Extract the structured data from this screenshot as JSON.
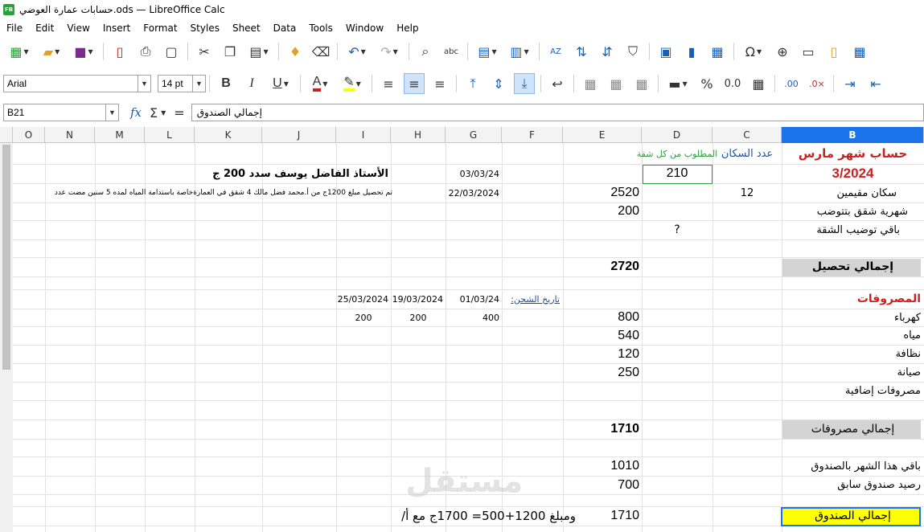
{
  "window": {
    "title": "حسابات عمارة العوضي.ods — LibreOffice Calc",
    "app_icon_text": "FB"
  },
  "menu": [
    "File",
    "Edit",
    "View",
    "Insert",
    "Format",
    "Styles",
    "Sheet",
    "Data",
    "Tools",
    "Window",
    "Help"
  ],
  "format_toolbar": {
    "font_name": "Arial",
    "font_size": "14 pt"
  },
  "formula_bar": {
    "cell_ref": "B21",
    "content": "إجمالي الصندوق"
  },
  "columns": [
    {
      "id": "O",
      "label": "O"
    },
    {
      "id": "N",
      "label": "N"
    },
    {
      "id": "M",
      "label": "M"
    },
    {
      "id": "L",
      "label": "L"
    },
    {
      "id": "K",
      "label": "K"
    },
    {
      "id": "J",
      "label": "J"
    },
    {
      "id": "I",
      "label": "I"
    },
    {
      "id": "H",
      "label": "H"
    },
    {
      "id": "G",
      "label": "G"
    },
    {
      "id": "F",
      "label": "F"
    },
    {
      "id": "E",
      "label": "E"
    },
    {
      "id": "D",
      "label": "D"
    },
    {
      "id": "C",
      "label": "C"
    },
    {
      "id": "B",
      "label": "B"
    }
  ],
  "colors": {
    "red": "#c9211e",
    "blue": "#1f4e99",
    "green": "#2e9e3e",
    "selection": "#1a73e8",
    "total_fill": "#d4d4d4",
    "highlight": "#ffff00"
  },
  "cells": {
    "b1": "حساب شهر مارس",
    "c1": "عدد السكان",
    "d1": "المطلوب من كل شقة",
    "b2": "3/2024",
    "d2": "210",
    "g2": "03/03/24",
    "j2": "الأستاذ الفاضل يوسف سدد 200 ج",
    "b3": "سكان مقيمين",
    "c3": "12",
    "e3": "2520",
    "g3": "22/03/2024",
    "k3": "تم تحصيل مبلغ 1200ج من أ.محمد فضل مالك 4 شقق في العمارةخاصة باستدامة المياه لمده 5 سنين مضت عدد",
    "b4": "شهرية شقق بتتوضب",
    "e4": "200",
    "b5": "باقي توضيب الشقة",
    "d5": "?",
    "b7": "إجمالي تحصيل",
    "e7": "2720",
    "b9": "المصروفات",
    "f9": "تاريخ الشحن:",
    "g9": "01/03/24",
    "h9": "19/03/2024",
    "i9": "25/03/2024",
    "b10": "كهرباء",
    "e10": "800",
    "g10": "400",
    "h10": "200",
    "i10": "200",
    "b11": "مياه",
    "e11": "540",
    "b12": "نظافة",
    "e12": "120",
    "b13": "صيانة",
    "e13": "250",
    "b14": "مصروفات إضافية",
    "b16": "إجمالي مصروفات",
    "e16": "1710",
    "b18": "باقي هذا الشهر بالصندوق",
    "e18": "1010",
    "b19": "رصيد صندوق سابق",
    "e19": "700",
    "b21": "إجمالي الصندوق",
    "e21": "1710",
    "g21": "ومبلغ 1200+500= 1700ج مع أ/"
  },
  "watermark": "مستقل"
}
